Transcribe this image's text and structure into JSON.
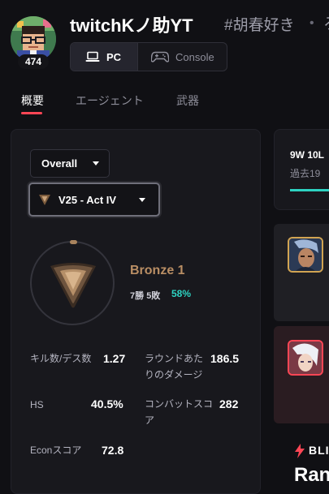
{
  "profile": {
    "name": "twitchKノ助YT",
    "tagline": "#胡春好き",
    "separator": "•",
    "overflow_text": "ろ",
    "level": "474",
    "avatar_icon": "pixel-art-avatar"
  },
  "platform": {
    "pc_label": "PC",
    "console_label": "Console",
    "selected": "PC"
  },
  "tabs": [
    {
      "label": "概要",
      "active": true
    },
    {
      "label": "エージェント",
      "active": false
    },
    {
      "label": "武器",
      "active": false
    }
  ],
  "filters": {
    "mode_label": "Overall",
    "act_label": "V25 - Act IV"
  },
  "rank": {
    "name": "Bronze 1",
    "wins": "7勝",
    "losses": "5敗",
    "win_pct": "58%",
    "icon": "bronze-rank-icon",
    "color": "#b98e64"
  },
  "stats": [
    {
      "label": "キル数/デス数",
      "value": "1.27"
    },
    {
      "label": "ラウンドあたりのダメージ",
      "value": "186.5"
    },
    {
      "label": "HS",
      "value": "40.5%"
    },
    {
      "label": "コンバットスコア",
      "value": "282"
    },
    {
      "label": "Econスコア",
      "value": "72.8"
    }
  ],
  "recent": {
    "record": "9W 10L",
    "subtitle": "過去19"
  },
  "brand": {
    "name": "BLI",
    "heading": "Ran"
  },
  "colors": {
    "accent": "#ff4655",
    "win": "#2ed3c2",
    "background": "#101014",
    "card": "#18181d"
  }
}
